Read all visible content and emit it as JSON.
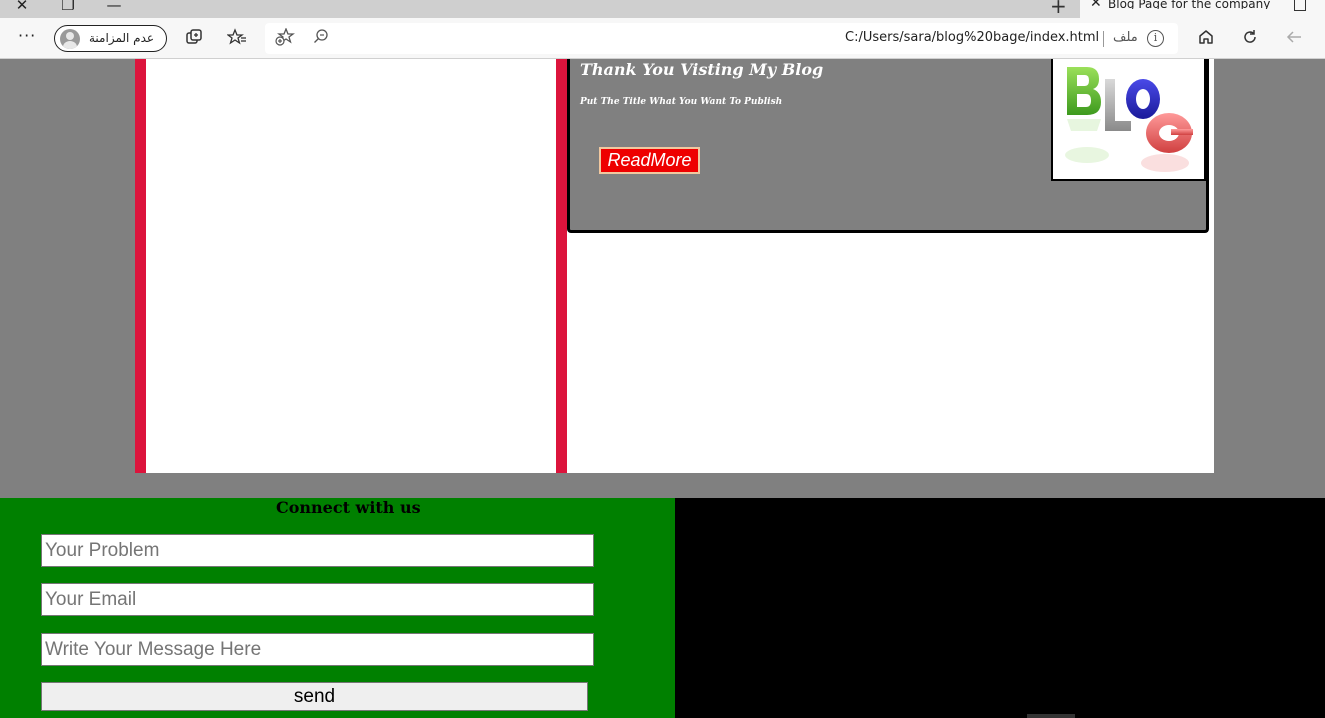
{
  "browser": {
    "tab_title": "Blog Page for the company",
    "profile_label": "عدم المزامنة",
    "url": "C:/Users/sara/blog%20bage/index.html",
    "scheme_label": "ملف",
    "info_symbol": "i",
    "more_symbol": "···"
  },
  "post": {
    "title": "Thank You Visting My Blog",
    "subtitle": "Put The Title What You Want To Publish",
    "read_more": "ReadMore",
    "image_text": "BLOG"
  },
  "contact": {
    "heading": "Connect with us",
    "problem_placeholder": "Your Problem",
    "email_placeholder": "Your Email",
    "message_placeholder": "Write Your Message Here",
    "send_label": "send"
  },
  "colors": {
    "page_bg": "#808080",
    "accent_red": "#dc143c",
    "button_red": "#ee0000",
    "footer_green": "#008000",
    "footer_black": "#000000"
  }
}
